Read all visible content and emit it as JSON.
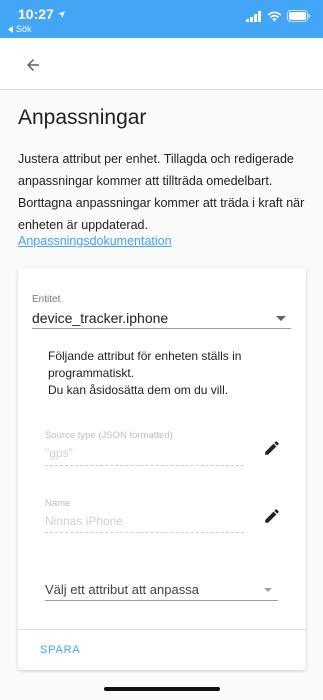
{
  "status_bar": {
    "time": "10:27",
    "back_app": "Sök",
    "icons": [
      "location-arrow-icon",
      "signal-icon",
      "wifi-icon",
      "battery-icon"
    ],
    "background": "#42a5f5"
  },
  "app_bar": {
    "back_icon": "arrow-left-icon"
  },
  "page": {
    "title": "Anpassningar",
    "description": "Justera attribut per enhet. Tillagda och redigerade anpassningar kommer att tillträda omedelbart. Borttagna anpassningar kommer att träda i kraft när enheten är uppdaterad.",
    "doc_link": "Anpassningsdokumentation"
  },
  "card": {
    "entity_label": "Entitet",
    "entity_value": "device_tracker.iphone",
    "info_line1": "Följande attribut för enheten ställs in programmatiskt.",
    "info_line2": "Du kan åsidosätta dem om du vill.",
    "attributes": [
      {
        "label": "Source type (JSON formatted)",
        "value": "\"gps\"",
        "icon": "pencil-icon"
      },
      {
        "label": "Name",
        "value": "Ninnas iPhone",
        "icon": "pencil-icon"
      }
    ],
    "select_placeholder": "Välj ett attribut att anpassa",
    "save_label": "SPARA"
  },
  "colors": {
    "accent": "#42a5f5",
    "text": "#212121",
    "disabled_text": "#bdbdbd"
  }
}
